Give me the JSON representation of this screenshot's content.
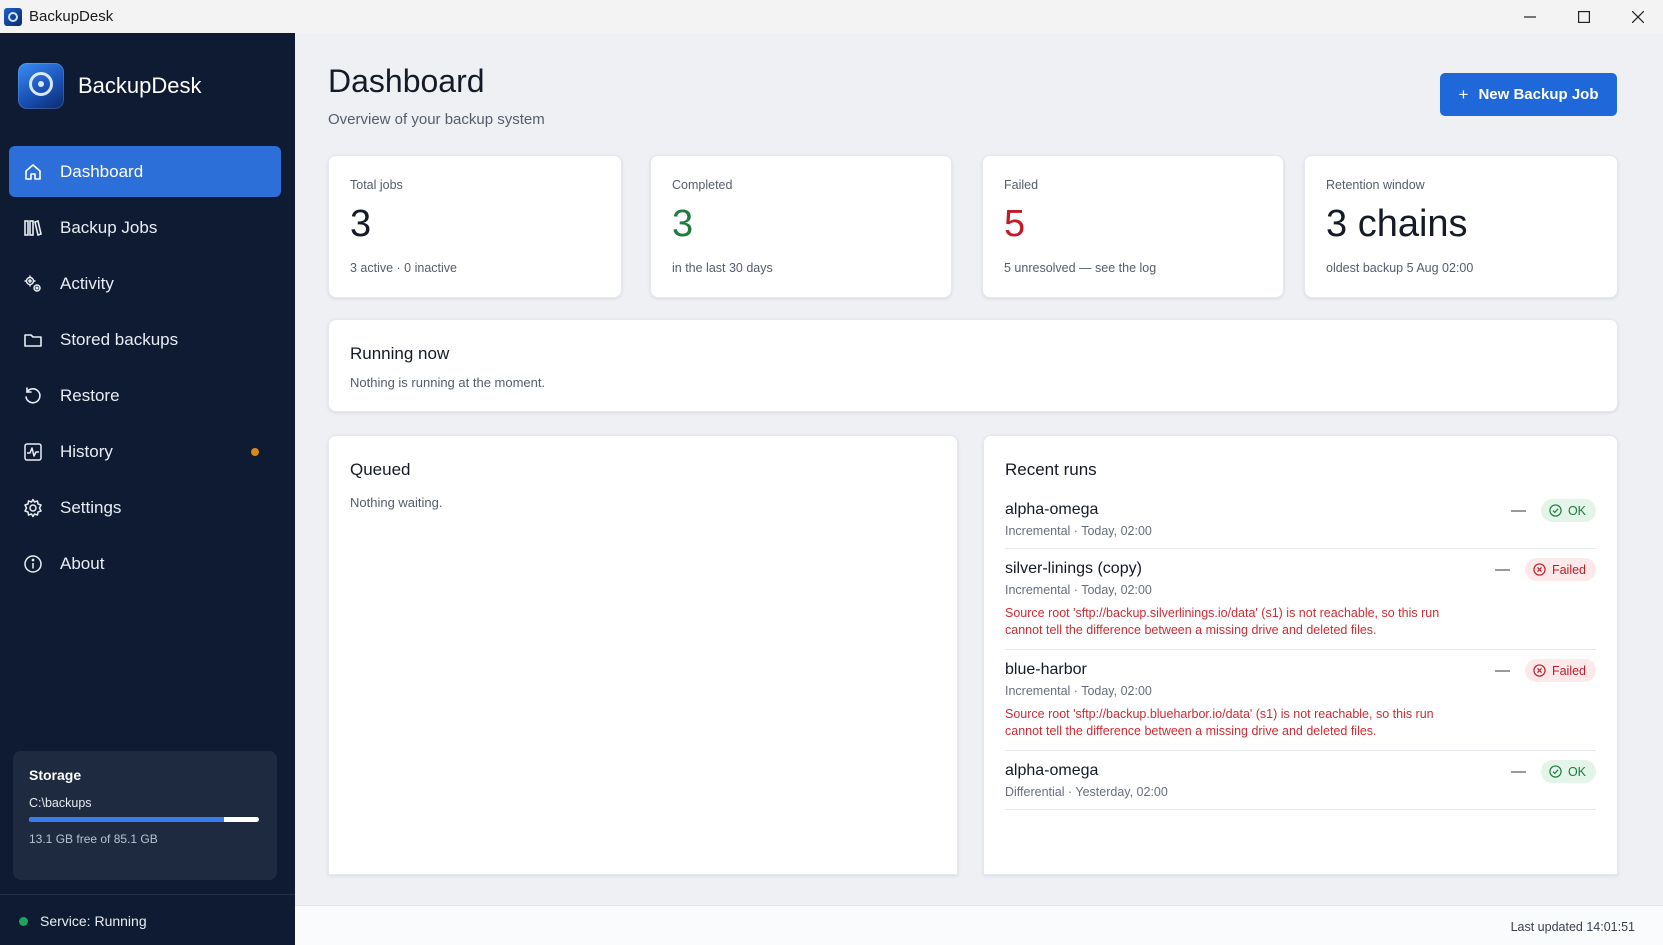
{
  "window": {
    "title": "BackupDesk"
  },
  "sidebar": {
    "brand": "BackupDesk",
    "items": [
      {
        "label": "Dashboard",
        "icon": "home-icon",
        "active": true
      },
      {
        "label": "Backup Jobs",
        "icon": "books-icon"
      },
      {
        "label": "Activity",
        "icon": "gears-icon"
      },
      {
        "label": "Stored backups",
        "icon": "folder-icon"
      },
      {
        "label": "Restore",
        "icon": "restore-icon"
      },
      {
        "label": "History",
        "icon": "pulse-icon",
        "has_dot": true
      },
      {
        "label": "Settings",
        "icon": "gear-icon"
      },
      {
        "label": "About",
        "icon": "info-icon"
      }
    ],
    "storage": {
      "title": "Storage",
      "path": "C:\\backups",
      "used_fraction": 0.846,
      "free_text": "13.1 GB free of 85.1 GB"
    },
    "service_status": "Service: Running"
  },
  "header": {
    "title": "Dashboard",
    "subtitle": "Overview of your backup system",
    "new_job_label": "New Backup Job",
    "new_job_icon": "+"
  },
  "stats": [
    {
      "label": "Total jobs",
      "value": "3",
      "sub": "3 active · 0 inactive"
    },
    {
      "label": "Completed",
      "value": "3",
      "sub": "in the last 30 days"
    },
    {
      "label": "Failed",
      "value": "5",
      "sub": "5 unresolved — see the log"
    },
    {
      "label": "Retention window",
      "value": "3 chains",
      "sub": "oldest backup 5 Aug 02:00"
    }
  ],
  "running": {
    "title": "Running now",
    "text": "Nothing is running at the moment."
  },
  "queued": {
    "title": "Queued",
    "text": "Nothing waiting."
  },
  "recent": {
    "title": "Recent runs",
    "runs": [
      {
        "name": "alpha-omega",
        "meta": "Incremental · Today, 02:00",
        "dash": "—",
        "status": "OK",
        "error": ""
      },
      {
        "name": "silver-linings (copy)",
        "meta": "Incremental · Today, 02:00",
        "dash": "—",
        "status": "Failed",
        "error": "Source root 'sftp://backup.silverlinings.io/data' (s1) is not reachable, so this run cannot tell the difference between a missing drive and deleted files."
      },
      {
        "name": "blue-harbor",
        "meta": "Incremental · Today, 02:00",
        "dash": "—",
        "status": "Failed",
        "error": "Source root 'sftp://backup.blueharbor.io/data' (s1) is not reachable, so this run cannot tell the difference between a missing drive and deleted files."
      },
      {
        "name": "alpha-omega",
        "meta": "Differential · Yesterday, 02:00",
        "dash": "—",
        "status": "OK",
        "error": ""
      }
    ]
  },
  "footer": {
    "last_updated": "Last updated 14:01:51"
  },
  "colors": {
    "sidebar_bg": "#0f1b33",
    "accent": "#1f68d9",
    "success": "#1e7c3e",
    "danger": "#c01c28",
    "warning_dot": "#d88a12"
  }
}
